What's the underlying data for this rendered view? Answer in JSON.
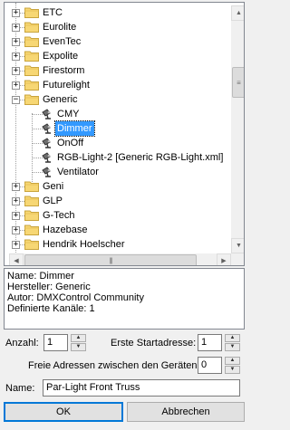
{
  "tree": {
    "nodes": [
      {
        "label": "ETC",
        "expander": "+"
      },
      {
        "label": "Eurolite",
        "expander": "+"
      },
      {
        "label": "EvenTec",
        "expander": "+"
      },
      {
        "label": "Expolite",
        "expander": "+"
      },
      {
        "label": "Firestorm",
        "expander": "+"
      },
      {
        "label": "Futurelight",
        "expander": "+"
      },
      {
        "label": "Generic",
        "expander": "−"
      },
      {
        "label": "CMY"
      },
      {
        "label": "Dimmer",
        "selected": true
      },
      {
        "label": "OnOff"
      },
      {
        "label": "RGB-Light-2 [Generic RGB-Light.xml]"
      },
      {
        "label": "Ventilator"
      },
      {
        "label": "Geni",
        "expander": "+"
      },
      {
        "label": "GLP",
        "expander": "+"
      },
      {
        "label": "G-Tech",
        "expander": "+"
      },
      {
        "label": "Hazebase",
        "expander": "+"
      },
      {
        "label": "Hendrik Hoelscher",
        "expander": "+"
      }
    ]
  },
  "scroll": {
    "up": "▲",
    "down": "▼",
    "left": "◀",
    "right": "▶",
    "grip": "≡",
    "hgrip": "|||"
  },
  "info": {
    "name_line": "Name: Dimmer",
    "maker_line": "Hersteller: Generic",
    "author_line": "Autor: DMXControl Community",
    "channels_line": "Definierte Kanäle: 1"
  },
  "form": {
    "count_label": "Anzahl:",
    "count_value": "1",
    "start_label": "Erste Startadresse:",
    "start_value": "1",
    "gap_label": "Freie Adressen zwischen den Geräten:",
    "gap_value": "0",
    "name_label": "Name:",
    "name_value": "Par-Light Front Truss",
    "spin_up": "▲",
    "spin_down": "▼"
  },
  "buttons": {
    "ok": "OK",
    "cancel": "Abbrechen"
  },
  "colors": {
    "folder": "#f7d774",
    "selection": "#3399ff"
  }
}
